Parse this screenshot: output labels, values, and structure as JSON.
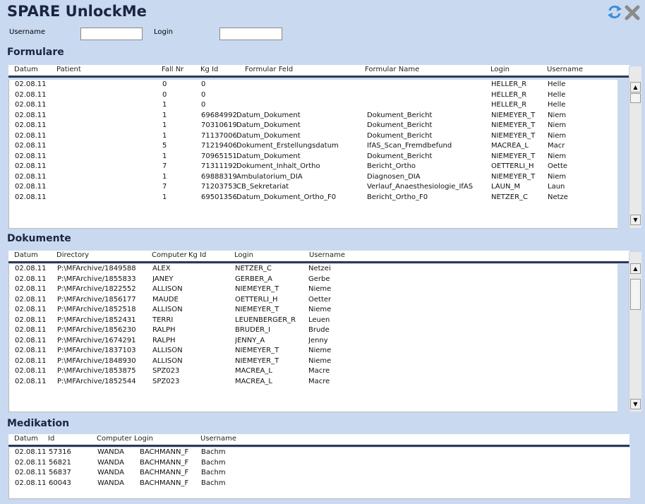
{
  "app": {
    "title": "SPARE UnlockMe"
  },
  "icons": {
    "refresh": "refresh-icon",
    "close": "close-icon"
  },
  "filters": {
    "username_label": "Username",
    "username_value": "",
    "login_label": "Login",
    "login_value": ""
  },
  "formulare": {
    "title": "Formulare",
    "headers": [
      "Datum",
      "Patient",
      "Fall Nr",
      "Kg Id",
      "Formular Feld",
      "Formular Name",
      "Login",
      "Username"
    ],
    "rows": [
      [
        "02.08.11",
        "",
        "0",
        "0",
        "",
        "",
        "HELLER_R",
        "Helle"
      ],
      [
        "02.08.11",
        "",
        "0",
        "0",
        "",
        "",
        "HELLER_R",
        "Helle"
      ],
      [
        "02.08.11",
        "",
        "1",
        "0",
        "",
        "",
        "HELLER_R",
        "Helle"
      ],
      [
        "02.08.11",
        "",
        "1",
        "69684992",
        "Datum_Dokument",
        "Dokument_Bericht",
        "NIEMEYER_T",
        "Niem"
      ],
      [
        "02.08.11",
        "",
        "1",
        "70310619",
        "Datum_Dokument",
        "Dokument_Bericht",
        "NIEMEYER_T",
        "Niem"
      ],
      [
        "02.08.11",
        "",
        "1",
        "71137006",
        "Datum_Dokument",
        "Dokument_Bericht",
        "NIEMEYER_T",
        "Niem"
      ],
      [
        "02.08.11",
        "",
        "5",
        "71219406",
        "Dokument_Erstellungsdatum",
        "IfAS_Scan_Fremdbefund",
        "MACREA_L",
        "Macr"
      ],
      [
        "02.08.11",
        "",
        "1",
        "70965151",
        "Datum_Dokument",
        "Dokument_Bericht",
        "NIEMEYER_T",
        "Niem"
      ],
      [
        "02.08.11",
        "",
        "7",
        "71311192",
        "Dokument_Inhalt_Ortho",
        "Bericht_Ortho",
        "OETTERLI_H",
        "Oette"
      ],
      [
        "02.08.11",
        "",
        "1",
        "69888319",
        "Ambulatorium_DIA",
        "Diagnosen_DIA",
        "NIEMEYER_T",
        "Niem"
      ],
      [
        "02.08.11",
        "",
        "7",
        "71203753",
        "CB_Sekretariat",
        "Verlauf_Anaesthesiologie_IfAS",
        "LAUN_M",
        "Laun"
      ],
      [
        "02.08.11",
        "",
        "1",
        "69501356",
        "Datum_Dokument_Ortho_F0",
        "Bericht_Ortho_F0",
        "NETZER_C",
        "Netze"
      ]
    ]
  },
  "dokumente": {
    "title": "Dokumente",
    "headers": [
      "Datum",
      "Directory",
      "Computer",
      "Kg Id",
      "Login",
      "Username"
    ],
    "rows": [
      [
        "02.08.11",
        "P:\\MFArchive/1849588",
        "ALEX",
        "",
        "NETZER_C",
        "Netzei"
      ],
      [
        "02.08.11",
        "P:\\MFArchive/1855833",
        "JANEY",
        "",
        "GERBER_A",
        "Gerbe"
      ],
      [
        "02.08.11",
        "P:\\MFArchive/1822552",
        "ALLISON",
        "",
        "NIEMEYER_T",
        "Nieme"
      ],
      [
        "02.08.11",
        "P:\\MFArchive/1856177",
        "MAUDE",
        "",
        "OETTERLI_H",
        "Oetter"
      ],
      [
        "02.08.11",
        "P:\\MFArchive/1852518",
        "ALLISON",
        "",
        "NIEMEYER_T",
        "Nieme"
      ],
      [
        "02.08.11",
        "P:\\MFArchive/1852431",
        "TERRI",
        "",
        "LEUENBERGER_R",
        "Leuen"
      ],
      [
        "02.08.11",
        "P:\\MFArchive/1856230",
        "RALPH",
        "",
        "BRUDER_I",
        "Brude"
      ],
      [
        "02.08.11",
        "P:\\MFArchive/1674291",
        "RALPH",
        "",
        "JENNY_A",
        "Jenny"
      ],
      [
        "02.08.11",
        "P:\\MFArchive/1837103",
        "ALLISON",
        "",
        "NIEMEYER_T",
        "Nieme"
      ],
      [
        "02.08.11",
        "P:\\MFArchive/1848930",
        "ALLISON",
        "",
        "NIEMEYER_T",
        "Nieme"
      ],
      [
        "02.08.11",
        "P:\\MFArchive/1853875",
        "SPZ023",
        "",
        "MACREA_L",
        "Macre"
      ],
      [
        "02.08.11",
        "P:\\MFArchive/1852544",
        "SPZ023",
        "",
        "MACREA_L",
        "Macre"
      ]
    ]
  },
  "medikation": {
    "title": "Medikation",
    "headers": [
      "Datum",
      "Id",
      "Computer",
      "Login",
      "Username"
    ],
    "rows": [
      [
        "02.08.11",
        "57316",
        "WANDA",
        "BACHMANN_F",
        "Bachm"
      ],
      [
        "02.08.11",
        "56821",
        "WANDA",
        "BACHMANN_F",
        "Bachm"
      ],
      [
        "02.08.11",
        "56837",
        "WANDA",
        "BACHMANN_F",
        "Bachm"
      ],
      [
        "02.08.11",
        "60043",
        "WANDA",
        "BACHMANN_F",
        "Bachm"
      ]
    ]
  },
  "scrollbar": {
    "up": "▲",
    "down": "▼"
  }
}
